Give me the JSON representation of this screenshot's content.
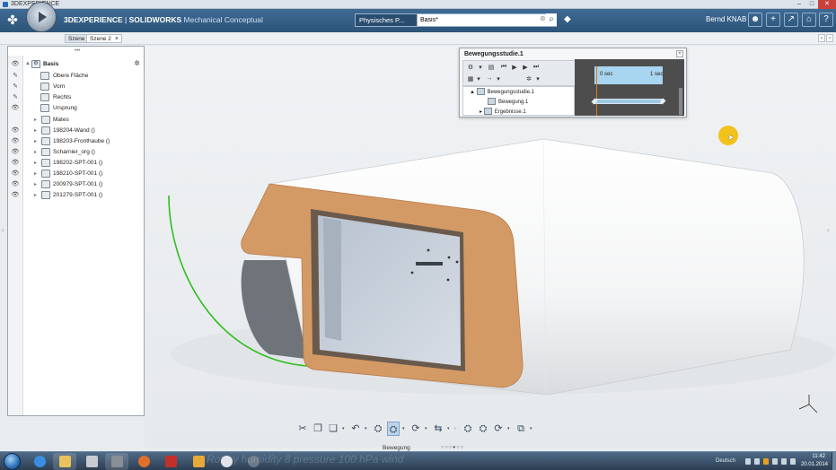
{
  "os_window": {
    "title": "3DEXPERIENCE",
    "buttons": [
      "–",
      "□",
      "✕"
    ]
  },
  "header": {
    "app_brand": "3DEXPERIENCE",
    "separator": " | ",
    "app_name": "SOLIDWORKS",
    "app_subtitle": " Mechanical Conceptual",
    "search_scope": "Physisches P...",
    "search_value": "Basis*",
    "user_name": "Bernd KNAB"
  },
  "scene_tabs": [
    {
      "label": "Szene 1",
      "active": false
    },
    {
      "label": "Szene 2",
      "active": true,
      "close": "×"
    }
  ],
  "tree": {
    "handle": "•••",
    "root": {
      "label": "Basis",
      "expander": "▲"
    },
    "items": [
      {
        "label": "Obere Fläche",
        "visible": "✎",
        "expander": "",
        "icon": ""
      },
      {
        "label": "Vorn",
        "visible": "✎",
        "expander": "",
        "icon": ""
      },
      {
        "label": "Rechts",
        "visible": "✎",
        "expander": "",
        "icon": ""
      },
      {
        "label": "Ursprung",
        "visible": "👁",
        "expander": "",
        "icon": ""
      },
      {
        "label": "Mates",
        "visible": "",
        "expander": "▸",
        "icon": ""
      },
      {
        "label": "198204-Wand ()",
        "visible": "👁",
        "expander": "▸",
        "icon": ""
      },
      {
        "label": "198203-Fronthaube ()",
        "visible": "👁",
        "expander": "▸",
        "icon": ""
      },
      {
        "label": "Scharnier_org ()",
        "visible": "👁",
        "expander": "▸",
        "icon": ""
      },
      {
        "label": "198202-SPT-001 ()",
        "visible": "👁",
        "expander": "▸",
        "icon": ""
      },
      {
        "label": "198210-SPT-001 ()",
        "visible": "👁",
        "expander": "▸",
        "icon": ""
      },
      {
        "label": "200979-SPT-001 ()",
        "visible": "👁",
        "expander": "▸",
        "icon": ""
      },
      {
        "label": "201279-SPT-001 ()",
        "visible": "👁",
        "expander": "▸",
        "icon": ""
      }
    ]
  },
  "motion_study": {
    "title": "Bewegungsstudie.1",
    "close": "×",
    "timeline_start": "0 sec",
    "timeline_end": "1 sec",
    "tree": [
      {
        "label": "Bewegungsstudie.1",
        "expander": "▲"
      },
      {
        "label": "Bewegung.1",
        "expander": ""
      },
      {
        "label": "Ergebnisse.1",
        "expander": "▸"
      }
    ]
  },
  "action_bar": {
    "label": "Bewegung",
    "page_dots": "○○○●○○",
    "icons": [
      "cut-icon",
      "copy-icon",
      "paste-icon",
      "undo-icon",
      "motion-icon",
      "motion-active-icon",
      "rotate-icon",
      "link-icon",
      "assembly-icon",
      "mate-icon",
      "rotate2-icon",
      "group-icon"
    ]
  },
  "taskbar": {
    "language": "Deutsch",
    "time": "11:42",
    "date": "20.01.2014",
    "subtitle_ghost": "Rotary humidity 8 pressure 100 hPa wind"
  },
  "colors": {
    "header": "#2d5478",
    "panel_border": "#9aa4ae",
    "model_shell": "#ffffff",
    "model_bezel": "#d49a66",
    "motion_path": "#2fbf1f",
    "cursor_highlight": "#f2c21a",
    "timeline_cursor": "#e07a1a"
  }
}
